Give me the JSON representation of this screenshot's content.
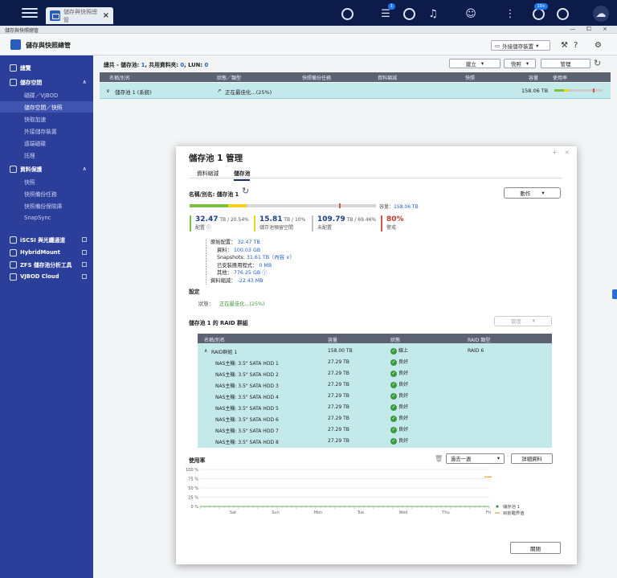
{
  "topbar": {
    "tab_label": "儲存與快照總管",
    "badge_tasks": "1",
    "badge_notify": "10+"
  },
  "window": {
    "title": "儲存與快照總管",
    "controls": "— ⧠ ×"
  },
  "header": {
    "title": "儲存與快照總管",
    "external_button": "外接儲存裝置"
  },
  "sidebar": {
    "overview": "總覽",
    "storage": "儲存空間",
    "storage_items": [
      "磁碟／VJBOD",
      "儲存空間／快照",
      "快取加速",
      "外接儲存裝置",
      "遠端磁碟",
      "託理"
    ],
    "protection": "資料保護",
    "protection_items": [
      "快照",
      "快照備份任務",
      "快照備份保險庫",
      "SnapSync"
    ],
    "iscsi": "iSCSI 與光纖通道",
    "hybrid": "HybridMount",
    "zfs": "ZFS 儲存池分析工具",
    "vjbod": "VJBOD Cloud"
  },
  "main": {
    "summary_label": "總共 - 儲存池: ",
    "summary_pools": "1",
    "summary_mid": ", 共用資料夾: ",
    "summary_folders": "0",
    "summary_lun_label": ", LUN: ",
    "summary_luns": "0",
    "btn_create": "建立",
    "btn_snapshot": "快照",
    "btn_manage": "管理",
    "columns": [
      "名稱/別名",
      "狀態／類型",
      "快照備份任務",
      "資料縮減",
      "快照",
      "容量",
      "使用率"
    ],
    "pool_row": {
      "name": "儲存池 1 (系統)",
      "status": "正在最佳化...(25%)",
      "capacity": "158.06 TB"
    }
  },
  "dialog": {
    "title": "儲存池 1 管理",
    "tabs": [
      "資料縮減",
      "儲存池"
    ],
    "name_label": "名稱/別名: 儲存池 1",
    "action_button": "動作",
    "capacity_label": "容量：",
    "capacity_value": "158.06 TB",
    "legend": [
      {
        "value": "32.47",
        "unit": " TB / 20.54%",
        "caption": "配置",
        "color": "#7cc242"
      },
      {
        "value": "15.81",
        "unit": " TB / 10%",
        "caption": "儲存池預留空間",
        "color": "#f2d21b"
      },
      {
        "value": "109.79",
        "unit": " TB / 69.46%",
        "caption": "未配置",
        "color": "#c0c0c0"
      },
      {
        "value": "80%",
        "unit": "",
        "caption": "警戒",
        "color": "#d9534f"
      }
    ],
    "alloc": {
      "allocated": 20.54,
      "reserved": 10,
      "unallocated": 69.46,
      "threshold": 80
    },
    "tree": [
      {
        "label": "原始配置：",
        "value": "32.47 TB"
      },
      {
        "label": "資料：",
        "value": "100.03 GB"
      },
      {
        "label": "Snapshots:",
        "value": "31.61 TB（內容 ∨）"
      },
      {
        "label": "已安裝應用程式：",
        "value": "0 MB"
      },
      {
        "label": "其他：",
        "value": "776.25 GB ⓘ"
      },
      {
        "label": "資料縮減：",
        "value": "-22.43 MB"
      }
    ],
    "settings_title": "設定",
    "status_label": "狀態：",
    "status_value": "正在最佳化...(25%)",
    "raid_title": "儲存池 1 的 RAID 群組",
    "raid_manage": "管理",
    "raid_columns": [
      "名稱/別名",
      "容量",
      "狀態",
      "RAID 類型"
    ],
    "raid_group": {
      "name": "RAID群組 1",
      "capacity": "158.00 TB",
      "status": "線上",
      "type": "RAID 6"
    },
    "disks": [
      {
        "name": "NAS主機: 3.5\" SATA HDD 1",
        "capacity": "27.29 TB",
        "status": "良好"
      },
      {
        "name": "NAS主機: 3.5\" SATA HDD 2",
        "capacity": "27.29 TB",
        "status": "良好"
      },
      {
        "name": "NAS主機: 3.5\" SATA HDD 3",
        "capacity": "27.29 TB",
        "status": "良好"
      },
      {
        "name": "NAS主機: 3.5\" SATA HDD 4",
        "capacity": "27.29 TB",
        "status": "良好"
      },
      {
        "name": "NAS主機: 3.5\" SATA HDD 5",
        "capacity": "27.29 TB",
        "status": "良好"
      },
      {
        "name": "NAS主機: 3.5\" SATA HDD 6",
        "capacity": "27.29 TB",
        "status": "良好"
      },
      {
        "name": "NAS主機: 3.5\" SATA HDD 7",
        "capacity": "27.29 TB",
        "status": "良好"
      },
      {
        "name": "NAS主機: 3.5\" SATA HDD 8",
        "capacity": "27.29 TB",
        "status": "良好"
      }
    ],
    "usage_title": "使用率",
    "range_select": "過去一週",
    "detail_button": "詳細資料",
    "close_button": "關閉"
  },
  "chart_data": {
    "type": "line",
    "y_ticks": [
      "100 %",
      "75 %",
      "50 %",
      "25 %",
      "0 %"
    ],
    "x_ticks": [
      "Sat",
      "Sun",
      "Mon",
      "Tue",
      "Wed",
      "Thu",
      "Fri"
    ],
    "ylim": [
      0,
      100
    ],
    "series": [
      {
        "name": "儲存池 1",
        "color": "#3a9a3a",
        "values": [
          0,
          0,
          0,
          0,
          0,
          0,
          0
        ]
      },
      {
        "name": "目前臨界值",
        "color": "#f08020",
        "values": [
          80,
          80,
          80,
          80,
          80,
          80,
          80
        ]
      }
    ]
  }
}
